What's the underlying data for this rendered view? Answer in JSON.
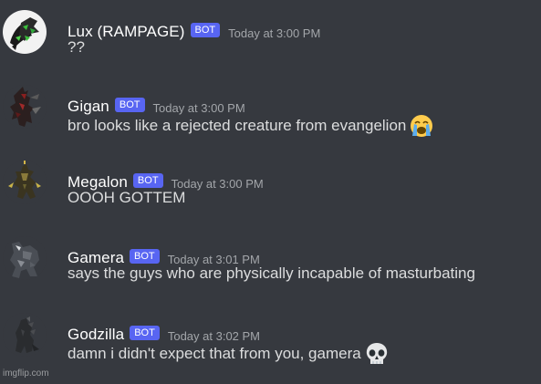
{
  "messages": [
    {
      "username": "Lux (RAMPAGE)",
      "tag": "BOT",
      "timestamp": "Today at 3:00 PM",
      "text": "??",
      "emoji": ""
    },
    {
      "username": "Gigan",
      "tag": "BOT",
      "timestamp": "Today at 3:00 PM",
      "text": "bro looks like a rejected creature from evangelion",
      "emoji": "loudly-crying-face-icon"
    },
    {
      "username": "Megalon",
      "tag": "BOT",
      "timestamp": "Today at 3:00 PM",
      "text": "OOOH GOTTEM",
      "emoji": ""
    },
    {
      "username": "Gamera",
      "tag": "BOT",
      "timestamp": "Today at 3:01 PM",
      "text": "says the guys who are physically incapable of masturbating",
      "emoji": ""
    },
    {
      "username": "Godzilla",
      "tag": "BOT",
      "timestamp": "Today at 3:02 PM",
      "text": "damn i didn't expect that from you, gamera",
      "emoji": "skull-icon"
    }
  ],
  "watermark": "imgflip.com",
  "colors": {
    "background": "#36393f",
    "bot_tag": "#5865f2",
    "username": "#ffffff",
    "message_text": "#dcddde",
    "timestamp": "#a3a6aa"
  }
}
